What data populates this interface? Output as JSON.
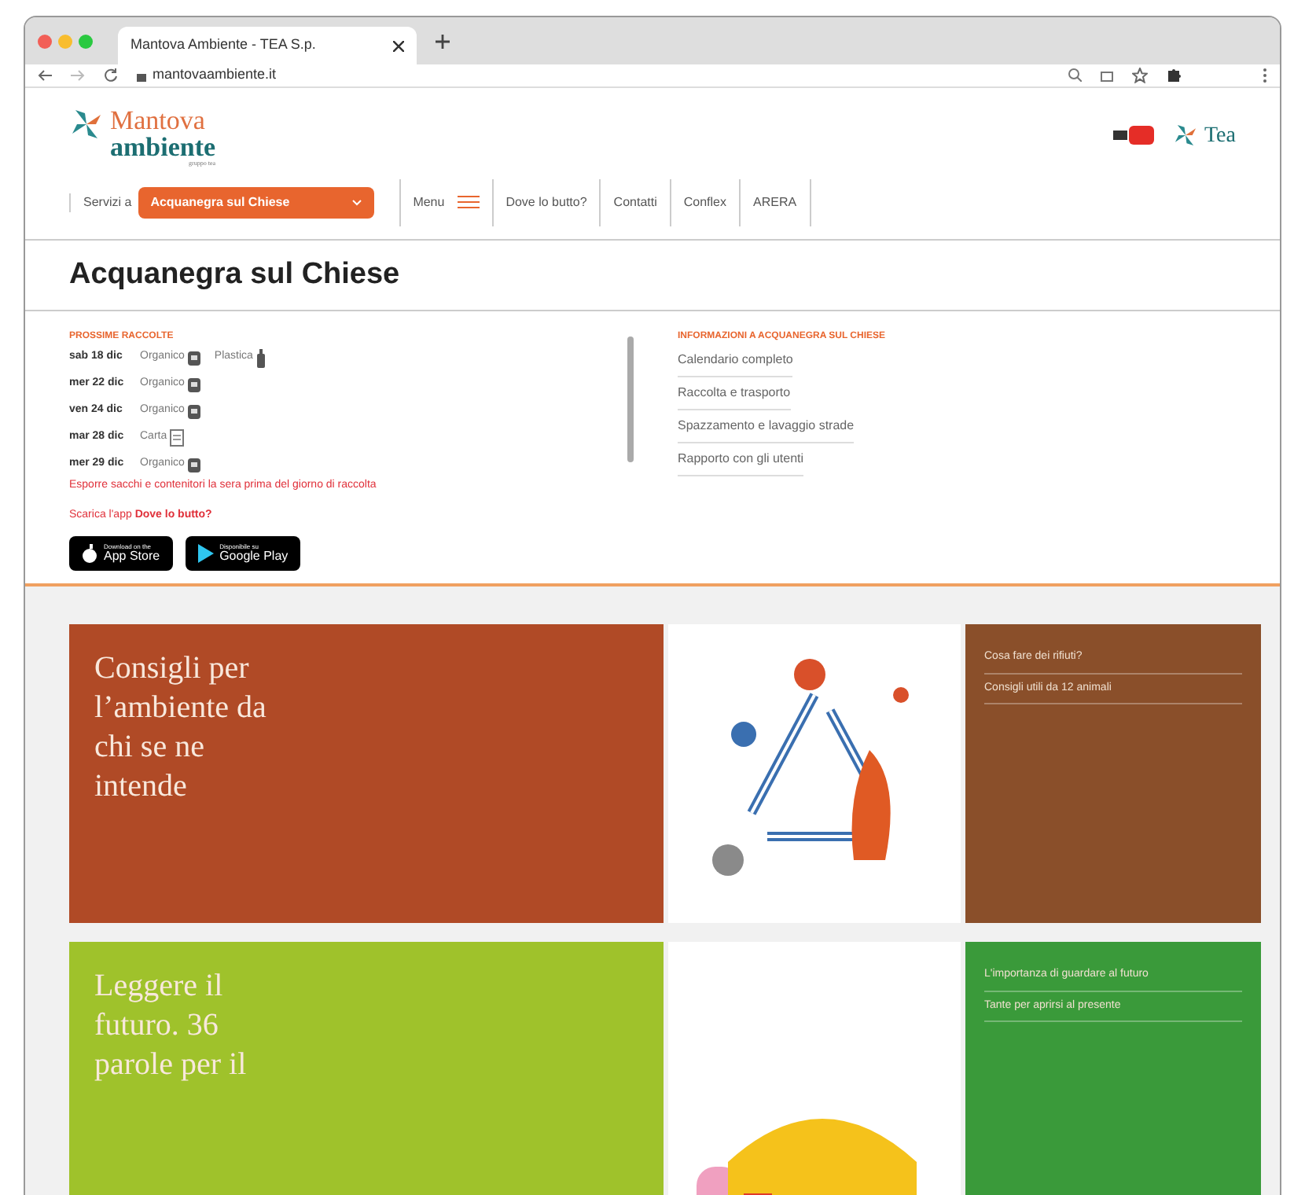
{
  "browser": {
    "tab_title": "Mantova Ambiente - TEA S.p.",
    "url": "mantovaambiente.it"
  },
  "header": {
    "logo_top": "Mantova",
    "logo_bottom": "ambiente",
    "logo_sub": "gruppo tea",
    "partner": "Tea"
  },
  "nav": {
    "label": "Servizi a",
    "select": "Acquanegra sul Chiese",
    "menu": "Menu",
    "links": [
      "Dove lo butto?",
      "Contatti",
      "Conflex",
      "ARERA"
    ]
  },
  "title": "Acquanegra sul Chiese",
  "collections": {
    "heading": "PROSSIME RACCOLTE",
    "rows": [
      {
        "date": "sab 18 dic",
        "items": [
          {
            "label": "Organico",
            "kind": "bin"
          },
          {
            "label": "Plastica",
            "kind": "bottle"
          }
        ]
      },
      {
        "date": "mer 22 dic",
        "items": [
          {
            "label": "Organico",
            "kind": "bin"
          }
        ]
      },
      {
        "date": "ven 24 dic",
        "items": [
          {
            "label": "Organico",
            "kind": "bin"
          }
        ]
      },
      {
        "date": "mar 28 dic",
        "items": [
          {
            "label": "Carta",
            "kind": "paper"
          }
        ]
      },
      {
        "date": "mer 29 dic",
        "items": [
          {
            "label": "Organico",
            "kind": "bin"
          }
        ]
      }
    ],
    "note": "Esporre sacchi e contenitori la sera prima del giorno di raccolta",
    "app_text": "Scarica l'app **Dove lo butto?**",
    "stores": [
      {
        "small": "Download on the",
        "name": "App Store",
        "kind": "apple"
      },
      {
        "small": "Disponibile su",
        "name": "Google Play",
        "kind": "google"
      }
    ]
  },
  "info": {
    "heading": "INFORMAZIONI A ACQUANEGRA SUL CHIESE",
    "links": [
      "Calendario completo",
      "Raccolta e trasporto",
      "Spazzamento e lavaggio strade",
      "Rapporto con gli utenti"
    ]
  },
  "cards": [
    {
      "title": "Consigli per l’ambiente da chi se ne intende",
      "color": "#b04a26",
      "kind": "recycling",
      "links": [
        "Cosa fare dei rifiuti?",
        "Consigli utili da 12 animali"
      ]
    },
    {
      "title": "Leggere il futuro. 36 parole per il",
      "color": "#9fc22b",
      "kind": "shapes",
      "links": [
        "L'importanza di guardare al futuro",
        "Tante per aprirsi al presente"
      ]
    }
  ]
}
